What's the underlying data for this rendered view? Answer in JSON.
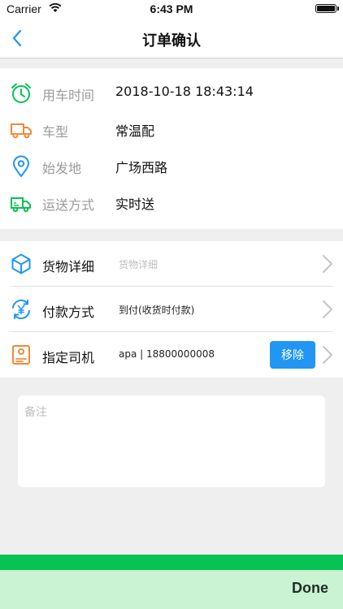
{
  "status_bar": {
    "carrier": "Carrier",
    "time": "6:43 PM"
  },
  "nav": {
    "title": "订单确认"
  },
  "info": [
    {
      "label": "用车时间",
      "value": "2018-10-18 18:43:14",
      "icon": "alarm-clock-icon"
    },
    {
      "label": "车型",
      "value": "常温配",
      "icon": "truck-icon"
    },
    {
      "label": "始发地",
      "value": "广场西路",
      "icon": "location-pin-icon"
    },
    {
      "label": "运送方式",
      "value": "实时送",
      "icon": "delivery-van-icon"
    }
  ],
  "options": {
    "goods": {
      "label": "货物详细",
      "placeholder": "货物详细",
      "icon": "box-icon"
    },
    "payment": {
      "label": "付款方式",
      "value": "到付(收货时付款)",
      "icon": "yuan-cycle-icon"
    },
    "driver": {
      "label": "指定司机",
      "value": "apa | 18800000008",
      "remove_label": "移除",
      "icon": "driver-card-icon"
    }
  },
  "remark": {
    "placeholder": "备注"
  },
  "keyboard_toolbar": {
    "done_label": "Done"
  },
  "colors": {
    "accent_blue": "#2196f3",
    "green": "#06c353",
    "orange": "#f0893a",
    "label_gray": "#9a9a9a"
  }
}
